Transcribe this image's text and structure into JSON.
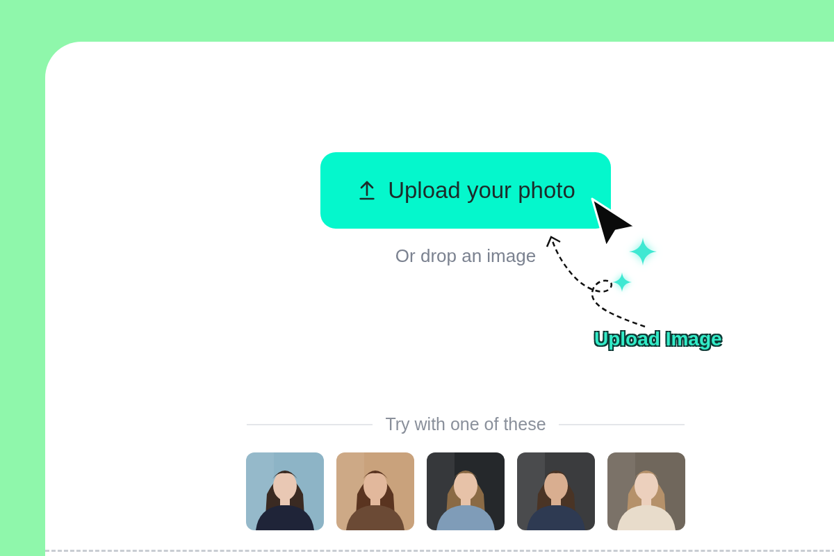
{
  "upload_button": {
    "label": "Upload your photo"
  },
  "drop_hint": "Or drop an image",
  "annotation": {
    "label": "Upload Image"
  },
  "samples": {
    "heading": "Try with one of these"
  }
}
